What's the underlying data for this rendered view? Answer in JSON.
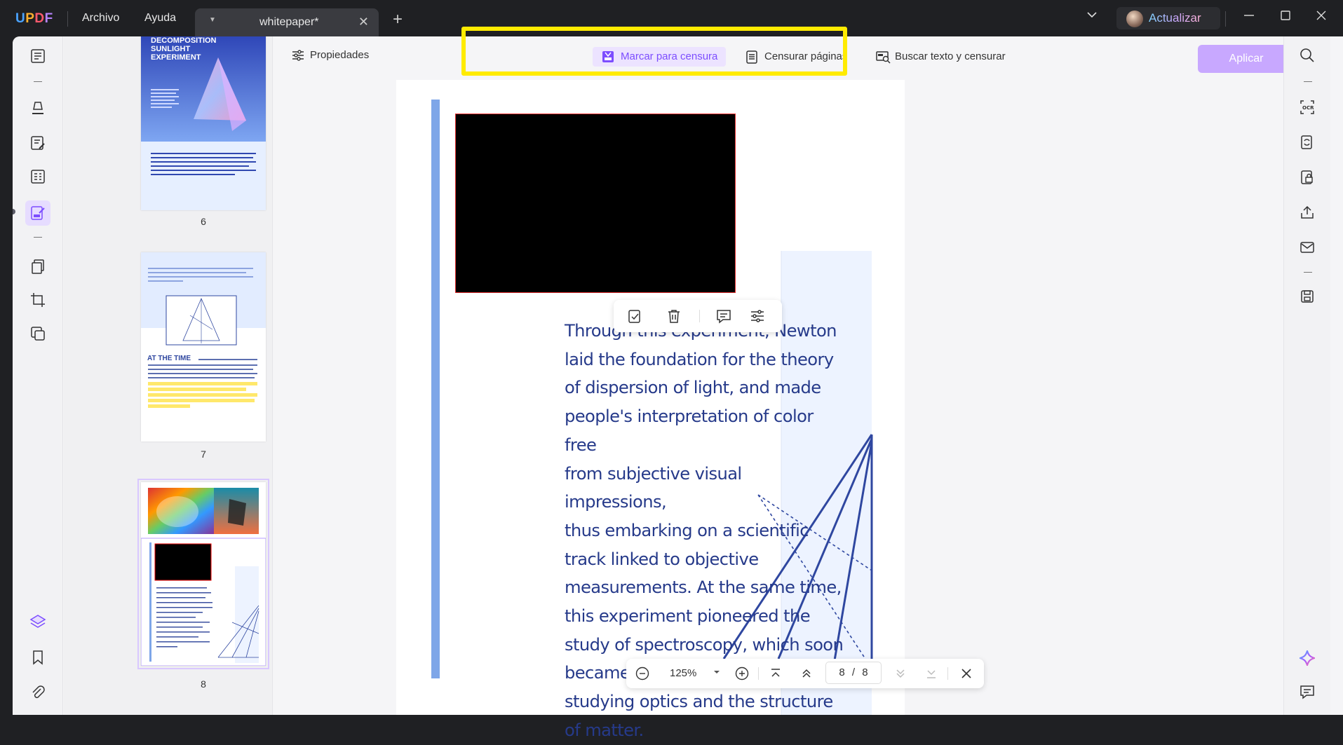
{
  "app": {
    "logo": "UPDF",
    "menu": [
      "Archivo",
      "Ayuda"
    ],
    "tab_name": "whitepaper*",
    "upgrade_label": "Actualizar"
  },
  "toolbar": {
    "properties_label": "Propiedades",
    "mark_redaction_label": "Marcar para censura",
    "redact_pages_label": "Censurar páginas",
    "search_redact_label": "Buscar texto y censurar",
    "apply_label": "Aplicar"
  },
  "thumbnails": [
    {
      "page": "6",
      "title_lines": [
        "DECOMPOSITION",
        "SUNLIGHT",
        "EXPERIMENT"
      ]
    },
    {
      "page": "7",
      "heading": "AT THE TIME"
    },
    {
      "page": "8"
    }
  ],
  "document": {
    "body_lines": [
      "Through this experiment, Newton",
      "laid the foundation for the theory",
      "of dispersion of light, and made",
      "people's interpretation of color free",
      "from subjective visual impressions,",
      "thus embarking on a scientific",
      "track linked to objective",
      "measurements. At the same time,",
      "this experiment pioneered the",
      "study of spectroscopy, which soon",
      "became the main means of",
      "studying optics and the structure",
      "of matter."
    ]
  },
  "zoom": {
    "value": "125%",
    "current_page": "8",
    "separator": "/",
    "total_pages": "8"
  },
  "colors": {
    "accent": "#7c4dff",
    "highlight": "#ffeb00",
    "text_blue": "#263a8a",
    "redaction": "#000000"
  }
}
